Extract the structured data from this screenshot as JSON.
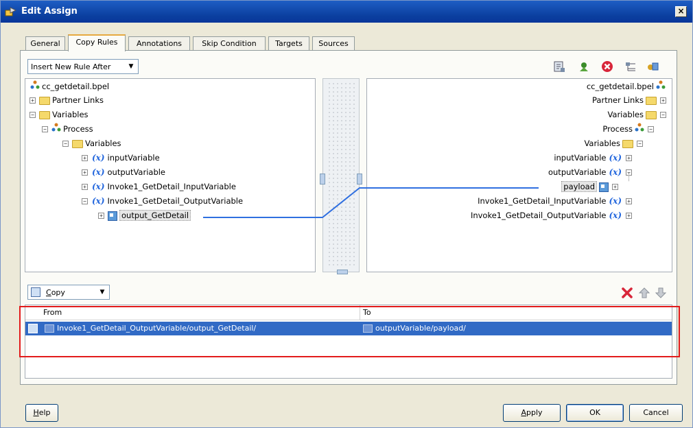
{
  "window": {
    "title": "Edit Assign",
    "close_glyph": "×"
  },
  "tabs": [
    {
      "label": "General",
      "active": false
    },
    {
      "label": "Copy Rules",
      "active": true
    },
    {
      "label": "Annotations",
      "active": false
    },
    {
      "label": "Skip Condition",
      "active": false
    },
    {
      "label": "Targets",
      "active": false
    },
    {
      "label": "Sources",
      "active": false
    }
  ],
  "toolbar": {
    "insert_select_value": "Insert New Rule After",
    "icons": [
      "expression-icon",
      "xml-fragment-icon",
      "delete-icon",
      "bulk-icon",
      "append-icon"
    ]
  },
  "left_tree": {
    "root": "cc_getdetail.bpel",
    "partner_links": "Partner Links",
    "variables": "Variables",
    "process": "Process",
    "process_variables": "Variables",
    "vars": [
      "inputVariable",
      "outputVariable",
      "Invoke1_GetDetail_InputVariable",
      "Invoke1_GetDetail_OutputVariable"
    ],
    "selected_child": "output_GetDetail",
    "var_glyph": "(x)"
  },
  "right_tree": {
    "root": "cc_getdetail.bpel",
    "partner_links": "Partner Links",
    "variables": "Variables",
    "process": "Process",
    "process_variables": "Variables",
    "input_var": "inputVariable",
    "output_var": "outputVariable",
    "selected_child": "payload",
    "invoke_input": "Invoke1_GetDetail_InputVariable",
    "invoke_output": "Invoke1_GetDetail_OutputVariable",
    "var_glyph": "(x)"
  },
  "copy_bar": {
    "select_value": "Copy",
    "select_underline": "C",
    "select_rest": "opy"
  },
  "rules_table": {
    "columns": [
      "From",
      "To"
    ],
    "rows": [
      {
        "from": "Invoke1_GetDetail_OutputVariable/output_GetDetail/",
        "to": "outputVariable/payload/"
      }
    ]
  },
  "buttons": {
    "help_u": "H",
    "help_rest": "elp",
    "apply_u": "A",
    "apply_rest": "pply",
    "ok": "OK",
    "cancel": "Cancel"
  },
  "colors": {
    "mapping_line": "#2f6fe0",
    "highlight_box": "#e21b1b",
    "selection": "#316ac5"
  }
}
